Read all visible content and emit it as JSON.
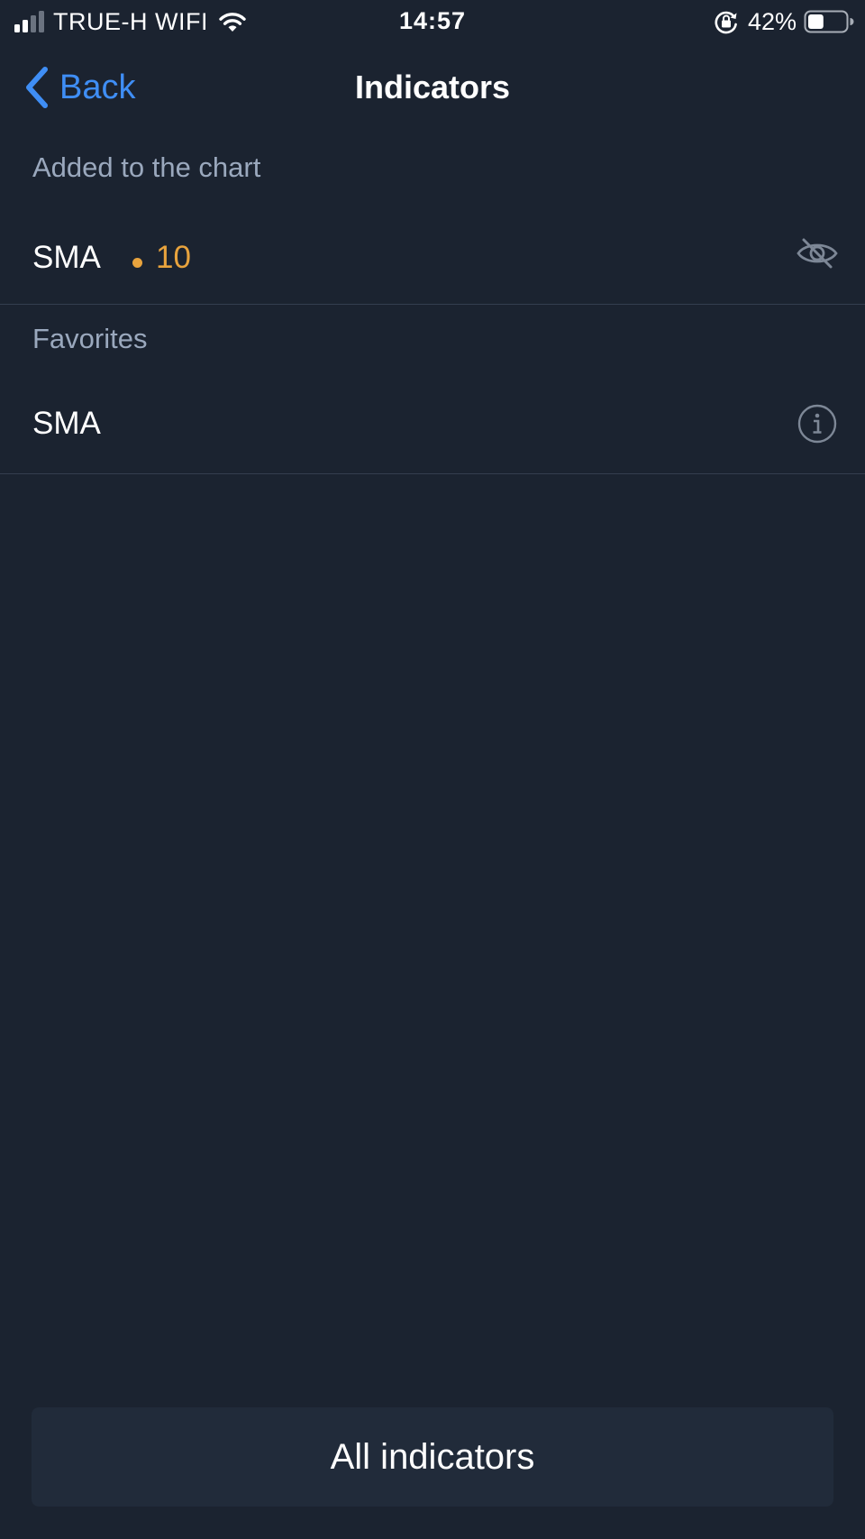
{
  "status_bar": {
    "carrier": "TRUE-H WIFI",
    "time": "14:57",
    "battery_percent": "42%",
    "battery_level": 0.42,
    "signal_bars": 2,
    "icons": [
      "signal-icon",
      "wifi-icon",
      "orientation-lock-icon",
      "battery-icon"
    ]
  },
  "nav": {
    "back_label": "Back",
    "title": "Indicators"
  },
  "sections": {
    "added": {
      "header": "Added to the chart",
      "items": [
        {
          "label": "SMA",
          "param": "10",
          "param_color": "#e8a33d",
          "action_icon": "eye-off-icon"
        }
      ]
    },
    "favorites": {
      "header": "Favorites",
      "items": [
        {
          "label": "SMA",
          "action_icon": "info-icon"
        }
      ]
    }
  },
  "footer": {
    "all_indicators_label": "All indicators"
  },
  "colors": {
    "background": "#1b2330",
    "accent": "#3f8ef5",
    "section_text": "#9aa8bd",
    "param": "#e8a33d",
    "button_bg": "#212b3a"
  }
}
